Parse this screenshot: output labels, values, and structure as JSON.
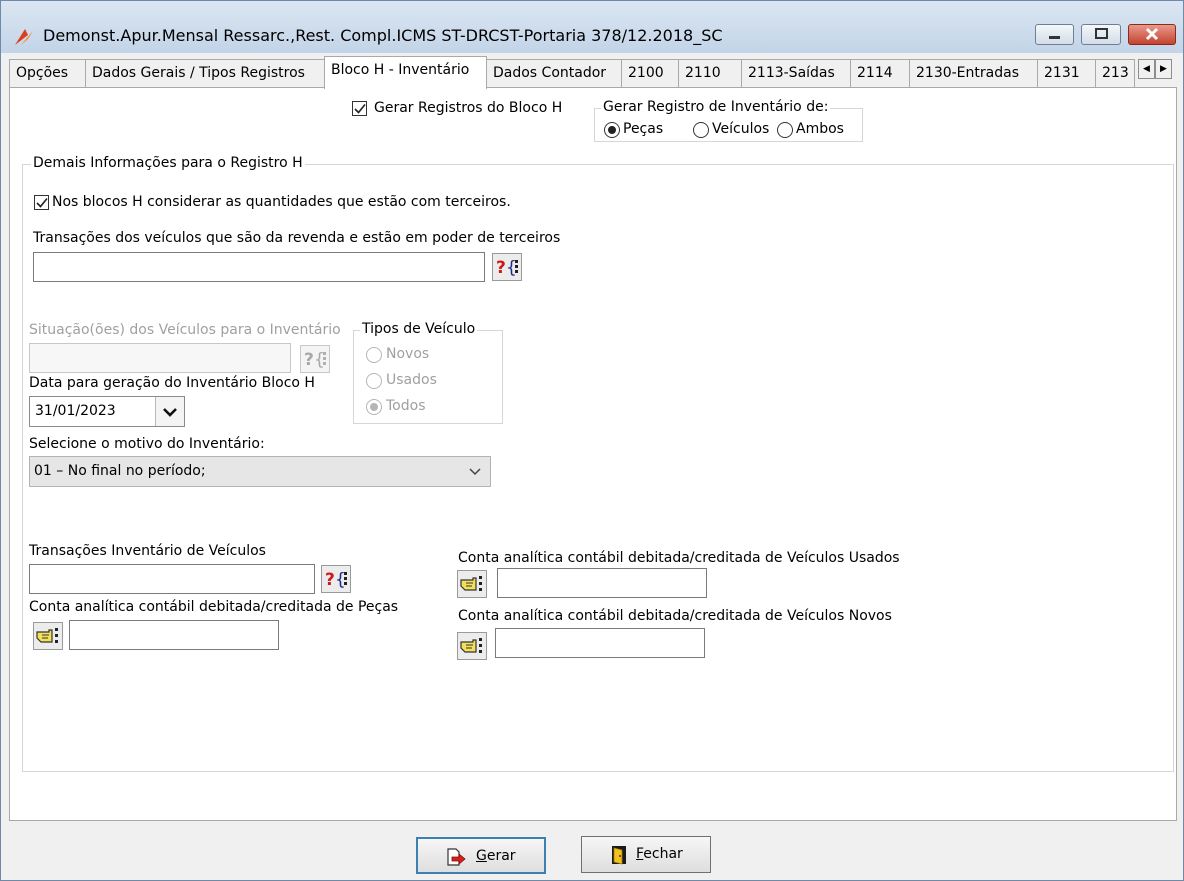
{
  "window": {
    "title": "Demonst.Apur.Mensal Ressarc.,Rest. Compl.ICMS ST-DRCST-Portaria 378/12.2018_SC",
    "controls": {
      "minimize": "minimize",
      "maximize": "maximize",
      "close": "close"
    }
  },
  "tabs": [
    {
      "label": "Opções"
    },
    {
      "label": "Dados Gerais / Tipos Registros"
    },
    {
      "label": "Bloco H - Inventário"
    },
    {
      "label": "Dados Contador"
    },
    {
      "label": "2100"
    },
    {
      "label": "2110"
    },
    {
      "label": "2113-Saídas"
    },
    {
      "label": "2114"
    },
    {
      "label": "2130-Entradas"
    },
    {
      "label": "2131"
    },
    {
      "label": "213"
    }
  ],
  "active_tab": "Bloco H - Inventário",
  "bloco_h": {
    "gerar_label": "Gerar Registros do Bloco H",
    "gerar_checked": true,
    "inventario_group": {
      "legend": "Gerar Registro de Inventário de:",
      "options": [
        "Peças",
        "Veículos",
        "Ambos"
      ],
      "selected": "Peças"
    }
  },
  "demais": {
    "legend": "Demais Informações para o Registro H",
    "terceiros_label": "Nos blocos H  considerar as quantidades que estão com terceiros.",
    "terceiros_checked": true,
    "transacoes_revenda_label": "Transações dos veículos que são da revenda e estão em poder de terceiros",
    "transacoes_revenda_value": "",
    "situacoes_label": "Situação(ões) dos Veículos para o Inventário",
    "situacoes_value": "",
    "tipos_veiculo": {
      "legend": "Tipos de Veículo",
      "options": [
        "Novos",
        "Usados",
        "Todos"
      ],
      "selected": "Todos"
    },
    "data_label": "Data para geração do Inventário Bloco H",
    "data_value": "31/01/2023",
    "motivo_label": "Selecione o motivo do Inventário:",
    "motivo_value": "01 – No final no período;",
    "transacoes_inventario_label": "Transações Inventário de Veículos",
    "transacoes_inventario_value": "",
    "conta_pecas_label": "Conta analítica contábil debitada/creditada de Peças",
    "conta_pecas_value": "",
    "conta_usados_label": "Conta analítica contábil debitada/creditada de Veículos Usados",
    "conta_usados_value": "",
    "conta_novos_label": "Conta analítica contábil debitada/creditada de Veículos Novos",
    "conta_novos_value": ""
  },
  "buttons": {
    "gerar": {
      "first": "G",
      "rest": "erar"
    },
    "fechar": {
      "first": "F",
      "rest": "echar"
    }
  },
  "icons": {
    "search_help": "search-help-icon",
    "hand_pointer": "hand-pointer-icon"
  }
}
